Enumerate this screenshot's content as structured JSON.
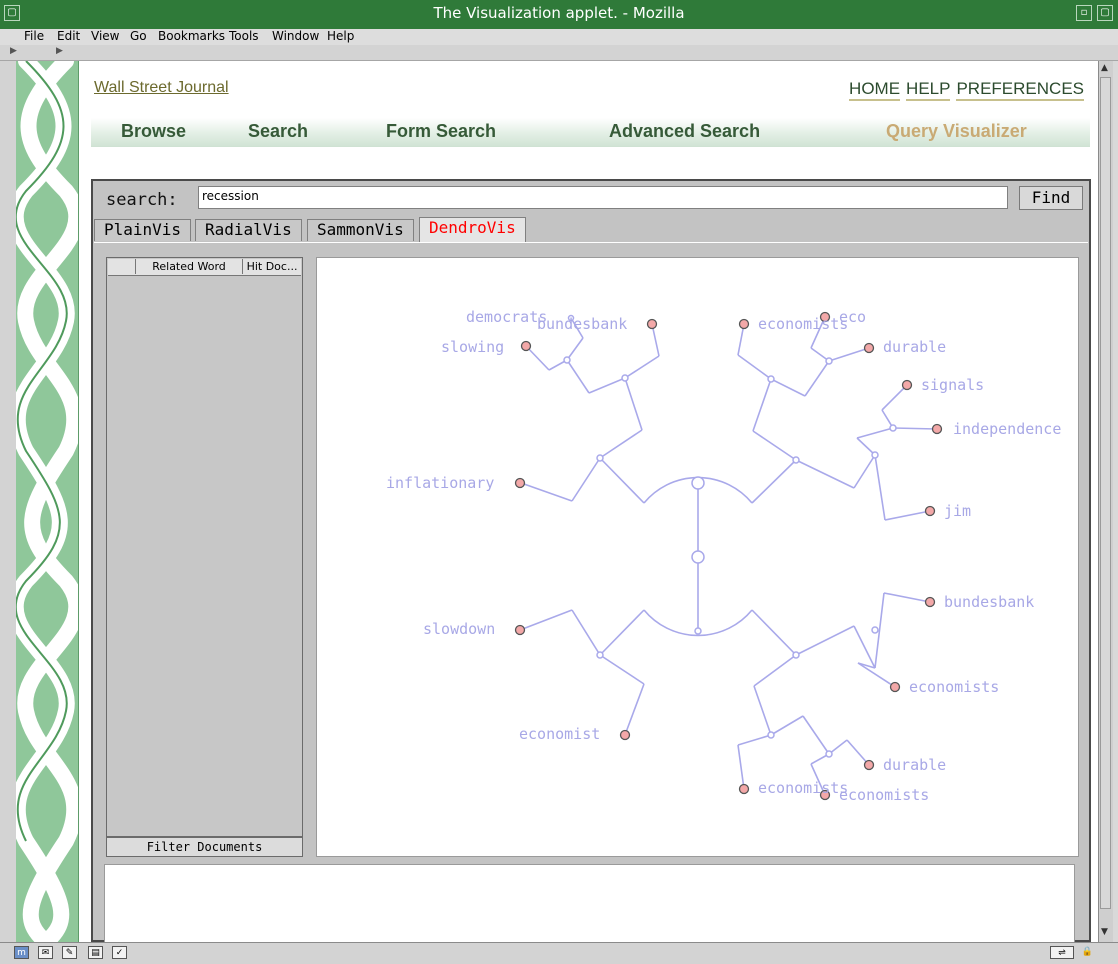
{
  "window": {
    "title": "The Visualization applet. - Mozilla"
  },
  "menu": [
    {
      "label": "File"
    },
    {
      "label": "Edit"
    },
    {
      "label": "View"
    },
    {
      "label": "Go"
    },
    {
      "label": "Bookmarks"
    },
    {
      "label": "Tools"
    },
    {
      "label": "Window"
    },
    {
      "label": "Help"
    }
  ],
  "site": {
    "brand": "Wall Street Journal",
    "top_links": [
      "HOME",
      "HELP",
      "PREFERENCES"
    ],
    "nav": [
      "Browse",
      "Search",
      "Form Search",
      "Advanced Search",
      "Query Visualizer"
    ],
    "active_nav": "Query Visualizer"
  },
  "applet": {
    "search_label": "search:",
    "search_value": "recession",
    "find_label": "Find",
    "tabs": [
      "PlainVis",
      "RadialVis",
      "SammonVis",
      "DendroVis"
    ],
    "active_tab": "DendroVis",
    "list_columns": [
      "",
      "Related Word",
      "Hit Doc..."
    ],
    "filter_label": "Filter Documents"
  },
  "dendrogram": {
    "leaves": [
      "democrats",
      "bundesbank",
      "slowing",
      "economists",
      "eco",
      "durable",
      "signals",
      "independence",
      "inflationary",
      "jim",
      "bundesbank",
      "slowdown",
      "economists",
      "economist",
      "durable",
      "economists",
      "economists"
    ]
  },
  "colors": {
    "titlebar": "#2f7a39",
    "tree": "#a6a6e8",
    "leaf_fill": "#f3a8a8",
    "active_tab_text": "#ff0000",
    "active_nav": "#c9aa74"
  }
}
